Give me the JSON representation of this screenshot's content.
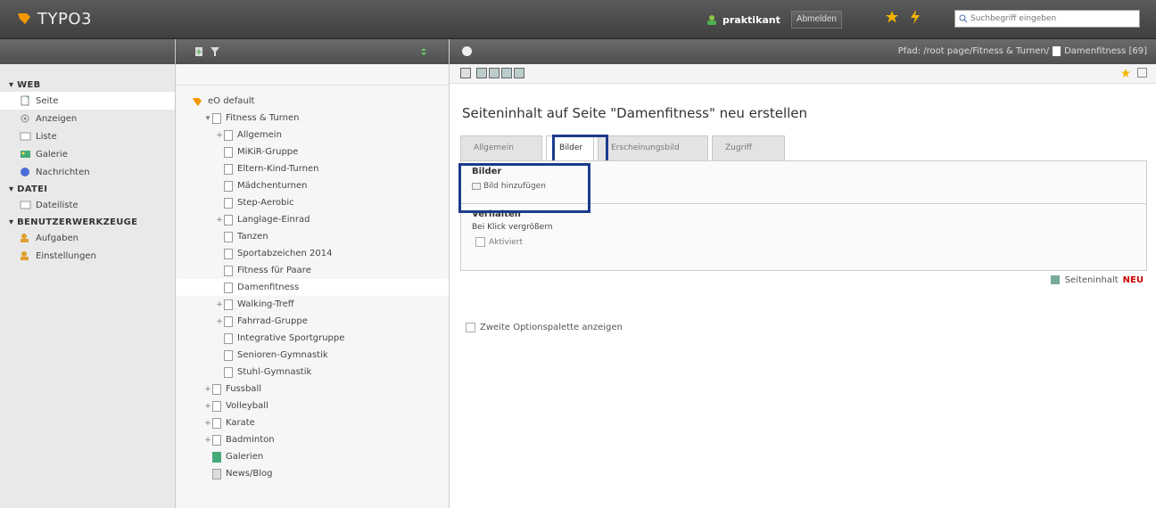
{
  "app": {
    "logo": "TYPO3"
  },
  "header": {
    "username": "praktikant",
    "logout": "Abmelden",
    "search_placeholder": "Suchbegriff eingeben"
  },
  "modules": [
    {
      "group": "WEB",
      "items": [
        {
          "label": "Seite",
          "icon": "page-icon",
          "active": true
        },
        {
          "label": "Anzeigen",
          "icon": "view-icon"
        },
        {
          "label": "Liste",
          "icon": "list-icon"
        },
        {
          "label": "Galerie",
          "icon": "gallery-icon"
        },
        {
          "label": "Nachrichten",
          "icon": "news-icon"
        }
      ]
    },
    {
      "group": "DATEI",
      "items": [
        {
          "label": "Dateiliste",
          "icon": "filelist-icon"
        }
      ]
    },
    {
      "group": "BENUTZERWERKZEUGE",
      "items": [
        {
          "label": "Aufgaben",
          "icon": "tasks-icon"
        },
        {
          "label": "Einstellungen",
          "icon": "settings-icon"
        }
      ]
    }
  ],
  "tree": {
    "nodes": [
      {
        "label": "eO default",
        "level": 0,
        "type": "root"
      },
      {
        "label": "Fitness & Turnen",
        "level": 1,
        "expander": "▾"
      },
      {
        "label": "Allgemein",
        "level": 2,
        "expander": "+"
      },
      {
        "label": "MiKiR-Gruppe",
        "level": 2
      },
      {
        "label": "Eltern-Kind-Turnen",
        "level": 2
      },
      {
        "label": "Mädchenturnen",
        "level": 2
      },
      {
        "label": "Step-Aerobic",
        "level": 2
      },
      {
        "label": "Langlage-Einrad",
        "level": 2,
        "expander": "+"
      },
      {
        "label": "Tanzen",
        "level": 2
      },
      {
        "label": "Sportabzeichen 2014",
        "level": 2
      },
      {
        "label": "Fitness für Paare",
        "level": 2
      },
      {
        "label": "Damenfitness",
        "level": 2,
        "selected": true
      },
      {
        "label": "Walking-Treff",
        "level": 2,
        "expander": "+"
      },
      {
        "label": "Fahrrad-Gruppe",
        "level": 2,
        "expander": "+"
      },
      {
        "label": "Integrative Sportgruppe",
        "level": 2
      },
      {
        "label": "Senioren-Gymnastik",
        "level": 2
      },
      {
        "label": "Stuhl-Gymnastik",
        "level": 2
      },
      {
        "label": "Fussball",
        "level": 1,
        "expander": "+"
      },
      {
        "label": "Volleyball",
        "level": 1,
        "expander": "+"
      },
      {
        "label": "Karate",
        "level": 1,
        "expander": "+"
      },
      {
        "label": "Badminton",
        "level": 1,
        "expander": "+"
      },
      {
        "label": "Galerien",
        "level": 1,
        "type": "gallery"
      },
      {
        "label": "News/Blog",
        "level": 1,
        "type": "folder"
      }
    ]
  },
  "content": {
    "path_prefix": "Pfad: /root page/Fitness & Turnen/",
    "path_page": "Damenfitness [69]",
    "title": "Seiteninhalt auf Seite \"Damenfitness\" neu erstellen",
    "tabs": [
      "Allgemein",
      "Bilder",
      "Erscheinungsbild",
      "Zugriff"
    ],
    "active_tab": "Bilder",
    "images_section": {
      "title": "Bilder",
      "add_label": "Bild hinzufügen"
    },
    "behaviour_section": {
      "title": "Verhalten",
      "field_label": "Bei Klick vergrößern",
      "checkbox_label": "Aktiviert"
    },
    "new_link": {
      "label": "Seiteninhalt",
      "badge": "NEU"
    },
    "second_options": "Zweite Optionspalette anzeigen"
  },
  "colors": {
    "highlight": "#1c3b8c",
    "logo_orange": "#f49700",
    "new_red": "#cc0000"
  }
}
